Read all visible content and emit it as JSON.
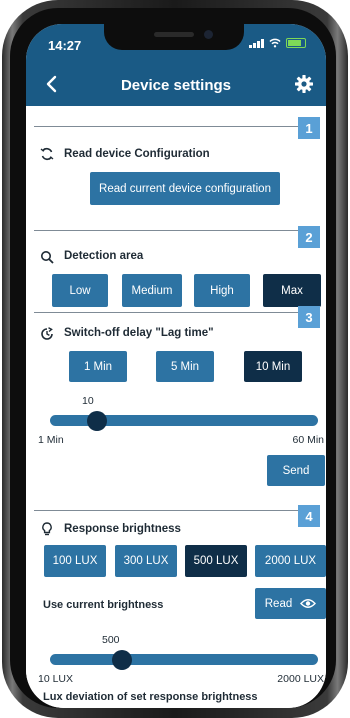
{
  "status_bar": {
    "time": "14:27"
  },
  "header": {
    "title": "Device settings"
  },
  "sections": {
    "read_config": {
      "number": "1",
      "title": "Read device Configuration",
      "button_label": "Read current device configuration"
    },
    "detection": {
      "number": "2",
      "title": "Detection area",
      "options": [
        "Low",
        "Medium",
        "High",
        "Max"
      ],
      "selected": "Max"
    },
    "lag": {
      "number": "3",
      "title": "Switch-off delay \"Lag time\"",
      "options": [
        "1 Min",
        "5 Min",
        "10 Min"
      ],
      "selected": "10 Min",
      "slider": {
        "value": "10",
        "min_label": "1 Min",
        "max_label": "60 Min",
        "level": 0.15
      },
      "send_label": "Send"
    },
    "brightness": {
      "number": "4",
      "title": "Response brightness",
      "options": [
        "100 LUX",
        "300 LUX",
        "500 LUX",
        "2000 LUX"
      ],
      "selected": "500 LUX",
      "use_current_label": "Use current brightness",
      "read_label": "Read",
      "slider": {
        "value": "500",
        "min_label": "10 LUX",
        "max_label": "2000 LUX",
        "level": 0.25
      },
      "deviation_label": "Lux deviation of set response brightness"
    }
  },
  "colors": {
    "header": "#1a5a85",
    "button": "#2d73a3",
    "button_active": "#0f2e48",
    "badge": "#5aa0d6"
  },
  "icons": [
    "back-chevron-icon",
    "gear-icon",
    "sync-icon",
    "search-icon",
    "timer-icon",
    "bulb-icon",
    "eye-icon"
  ]
}
